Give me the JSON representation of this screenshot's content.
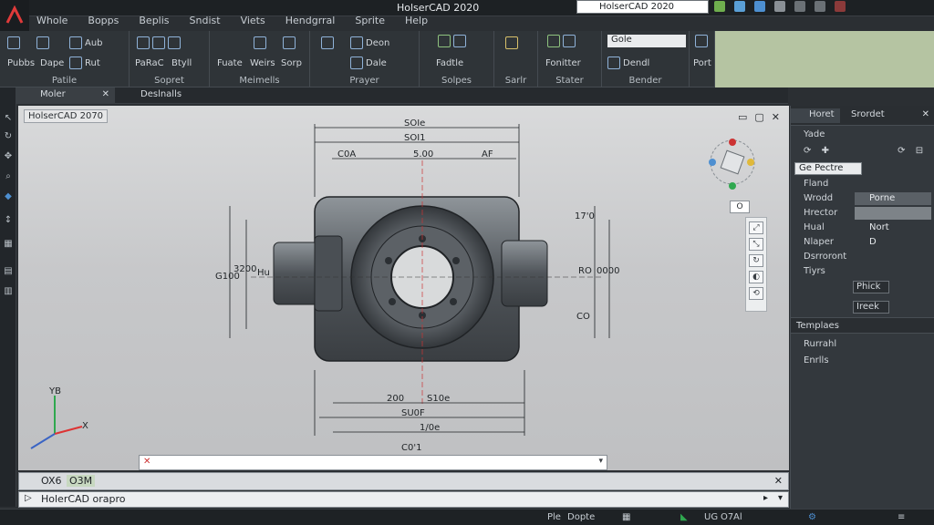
{
  "app": {
    "title": "HolserCAD 2020",
    "search_text": "HolserCAD 2020"
  },
  "menu": [
    "Whole",
    "Bopps",
    "Beplis",
    "Sndist",
    "Viets",
    "Hendgrral",
    "Sprite",
    "Help"
  ],
  "ribbon": {
    "groups": [
      {
        "label": "Patile",
        "buttons": [
          "Pubbs",
          "Dape",
          "Aub",
          "Rut"
        ]
      },
      {
        "label": "Sopret",
        "buttons": [
          "PaRaC",
          "Btyll"
        ]
      },
      {
        "label": "Meimells",
        "buttons": [
          "Fuate",
          "Weirs",
          "Sorp"
        ]
      },
      {
        "label": "Prayer",
        "buttons": [
          "Deon",
          "Dale"
        ]
      },
      {
        "label": "Solpes",
        "buttons": [
          "Fadtle"
        ]
      },
      {
        "label": "Sarlr",
        "buttons": []
      },
      {
        "label": "Stater",
        "buttons": [
          "Fonitter"
        ]
      },
      {
        "label": "Bender",
        "buttons": [
          "Gole",
          "Dendl"
        ]
      },
      {
        "label": "",
        "buttons": [
          "Port"
        ]
      }
    ]
  },
  "doc_tabs": [
    "Moler",
    "Deslnalls"
  ],
  "viewport": {
    "label": "HolserCAD 2070",
    "wcs_button": "O",
    "dimensions": [
      "SOIe",
      "SOI1",
      "C0A",
      "5.00",
      "AF",
      "17'0",
      "G100",
      "3200",
      "Hu",
      "RO",
      "0000",
      "CO",
      "200",
      "S10e",
      "SU0F",
      "1/0e",
      "C0'1"
    ]
  },
  "axis": {
    "x": "X",
    "y": "YB"
  },
  "command": {
    "history_prefix": "OX6",
    "history_text": "O3M",
    "input_text": "HolerCAD orapro"
  },
  "status": {
    "items": [
      "Ple",
      "Dopte",
      "UG",
      "O7",
      "Al"
    ]
  },
  "rpanel": {
    "tabs": [
      "Horet",
      "Srordet"
    ],
    "header": "Yade",
    "select_value": "Ge Pectre",
    "section_title": "Fland",
    "rows": [
      {
        "label": "Wrodd",
        "value": "Porne"
      },
      {
        "label": "Hrector",
        "value": ""
      },
      {
        "label": "Hual",
        "value": "Nort"
      },
      {
        "label": "Nlaper",
        "value": "D"
      },
      {
        "label": "Dsrroront",
        "value": ""
      }
    ],
    "subsection": "Tiyrs",
    "dd1": "Phick",
    "dd2": "Ireek",
    "section2_title": "Templaes",
    "section2_rows": [
      "Rurrahl",
      "Enrlls"
    ]
  },
  "colors": {
    "accent": "#4d8fd1",
    "ribbon_bg": "#2f3438",
    "viewport_bg": "#c8c9cb",
    "green_panel": "#b5c4a2"
  }
}
